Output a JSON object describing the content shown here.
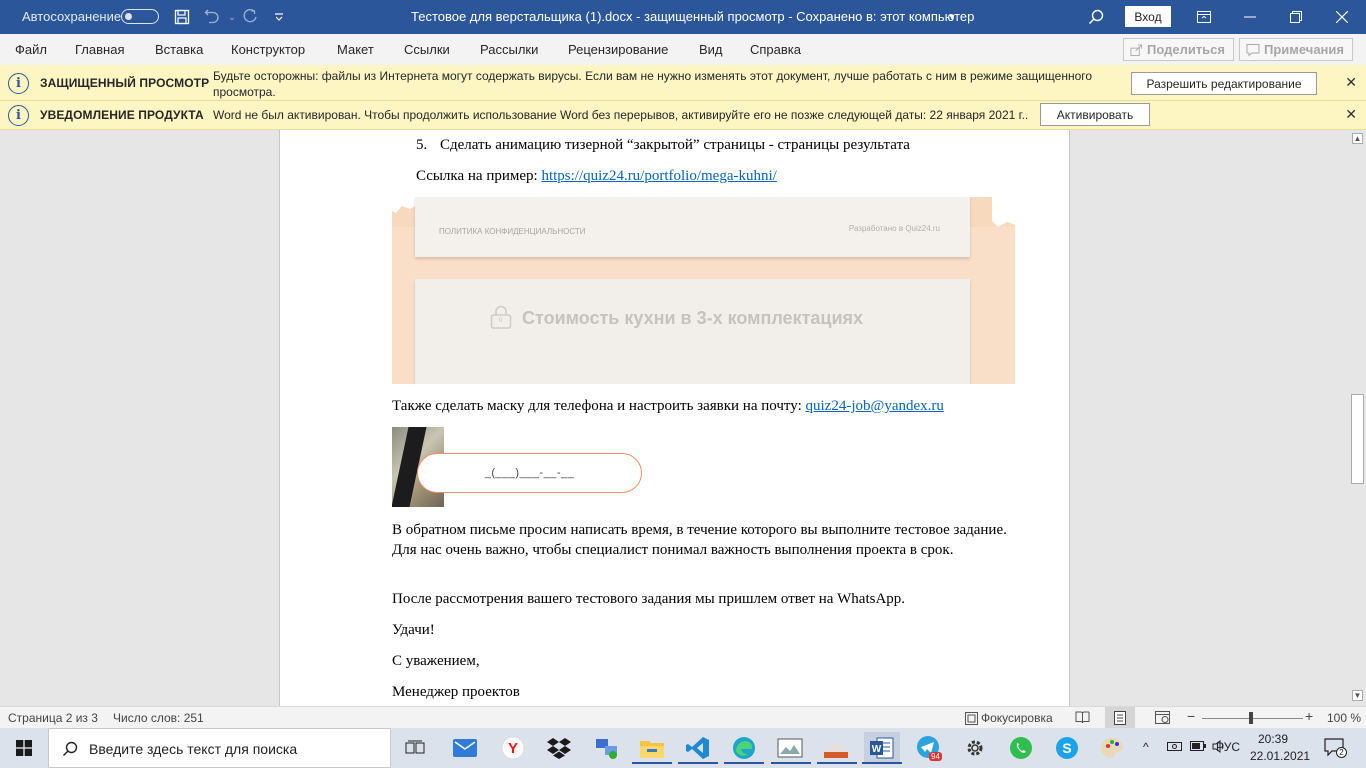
{
  "titlebar": {
    "autosave_label": "Автосохранение",
    "title": "Тестовое для верстальщика (1).docx  -  защищенный просмотр  -  Сохранено в: этот компьютер",
    "signin_label": "Вход"
  },
  "menu": {
    "items": [
      "Файл",
      "Главная",
      "Вставка",
      "Конструктор",
      "Макет",
      "Ссылки",
      "Рассылки",
      "Рецензирование",
      "Вид",
      "Справка"
    ],
    "share_label": "Поделиться",
    "comments_label": "Примечания"
  },
  "protected_bar": {
    "title": "ЗАЩИЩЕННЫЙ ПРОСМОТР",
    "text_line1": "Будьте осторожны: файлы из Интернета могут содержать вирусы. Если вам не нужно изменять этот документ, лучше работать с ним в режиме защищенного",
    "text_line2": "просмотра.",
    "button": "Разрешить редактирование"
  },
  "product_bar": {
    "title": "УВЕДОМЛЕНИЕ ПРОДУКТА",
    "text": "Word не был активирован. Чтобы продолжить использование Word без перерывов, активируйте его не позже следующей даты: 22 января 2021 г..",
    "button": "Активировать"
  },
  "document": {
    "item5_number": "5.",
    "item5_text": "Сделать анимацию тизерной “закрытой” страницы - страницы результата",
    "example_label": "Ссылка на пример: ",
    "example_link": "https://quiz24.ru/portfolio/mega-kuhni/",
    "image1": {
      "footer_left": "ПОЛИТИКА КОНФИДЕНЦИАЛЬНОСТИ",
      "footer_right": "Разработано в Quiz24.ru",
      "locked_heading": "Стоимость кухни в 3-х комплектациях",
      "lock_badge": "0"
    },
    "mask_label": "Также сделать маску для телефона и настроить заявки на почту: ",
    "mask_email": "quiz24-job@yandex.ru",
    "image2": {
      "phone_mask": "_(___)___-__-__"
    },
    "para1": "В обратном письме просим написать время, в течение которого вы выполните тестовое задание. Для нас очень важно, чтобы специалист понимал важность выполнения проекта в срок.",
    "para2": "После рассмотрения вашего тестового задания мы пришлем ответ на WhatsApp.",
    "para3": "Удачи!",
    "para4": "С уважением,",
    "para5": "Менеджер проектов"
  },
  "statusbar": {
    "page": "Страница 2 из 3",
    "words": "Число слов: 251",
    "focus": "Фокусировка",
    "zoom_minus": "−",
    "zoom_plus": "+",
    "zoom": "100 %"
  },
  "taskbar": {
    "search_placeholder": "Введите здесь текст для поиска",
    "telegram_badge": "94",
    "lang": "РУС",
    "time": "20:39",
    "date": "22.01.2021",
    "notifications": "2"
  },
  "colors": {
    "word_blue": "#2b579a",
    "message_bar": "#fdf6c3",
    "link": "#0563c1",
    "accent_orange": "#ee8f5e"
  }
}
